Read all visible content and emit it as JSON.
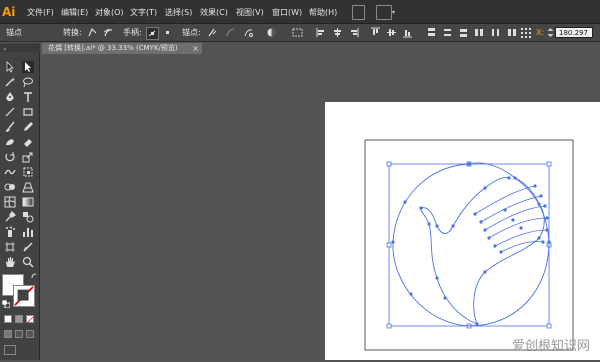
{
  "app": {
    "logo": "Ai"
  },
  "menu": {
    "items": [
      "文件(F)",
      "编辑(E)",
      "对象(O)",
      "文字(T)",
      "选择(S)",
      "效果(C)",
      "视图(V)",
      "窗口(W)",
      "帮助(H)"
    ]
  },
  "control_bar": {
    "anchor_label": "锚点",
    "convert_label": "转换:",
    "handle_label": "手柄:",
    "anchor_points_label": "锚点:",
    "x_label": "X:",
    "x_value": "180.297"
  },
  "document_tab": {
    "title": "花偶 [转换].ai* @ 33.33% (CMYK/预览)",
    "close": "×"
  },
  "watermark": "爱创根知识网",
  "colors": {
    "menubar_bg": "#323232",
    "controlbar_bg": "#464646",
    "canvas_bg": "#535353",
    "accent_logo": "#ff9a00",
    "path_selection": "#4a72e8"
  },
  "icons": {
    "tools": [
      "selection-tool-icon",
      "direct-selection-tool-icon",
      "magic-wand-icon",
      "lasso-icon",
      "pen-icon",
      "type-icon",
      "line-segment-icon",
      "rectangle-icon",
      "paintbrush-icon",
      "pencil-icon",
      "blob-brush-icon",
      "eraser-icon",
      "rotate-icon",
      "scale-icon",
      "warp-icon",
      "free-transform-icon",
      "shape-builder-icon",
      "perspective-grid-icon",
      "mesh-icon",
      "gradient-icon",
      "eyedropper-icon",
      "blend-icon",
      "symbol-sprayer-icon",
      "column-graph-icon",
      "artboard-icon",
      "slice-icon",
      "hand-icon",
      "zoom-icon"
    ]
  }
}
